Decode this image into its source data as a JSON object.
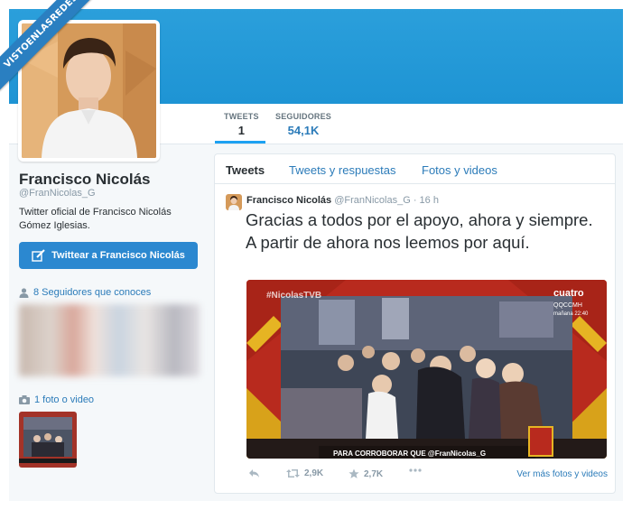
{
  "watermark": {
    "text": "VISTOENLASREDES"
  },
  "profile": {
    "name": "Francisco Nicolás",
    "handle": "@FranNicolas_G",
    "bio": "Twitter oficial de Francisco Nicolás Gómez Iglesias.",
    "tweet_to_button": "Twittear a Francisco Nicolás",
    "followers_you_know": "8 Seguidores que conoces",
    "photos_videos": "1 foto o video"
  },
  "stats": {
    "tweets": {
      "label": "TWEETS",
      "value": "1"
    },
    "followers": {
      "label": "SEGUIDORES",
      "value": "54,1K"
    }
  },
  "timeline": {
    "tabs": [
      "Tweets",
      "Tweets y respuestas",
      "Fotos y videos"
    ],
    "active_tab": "Tweets"
  },
  "tweet": {
    "author": "Francisco Nicolás",
    "handle": "@FranNicolas_G",
    "time": "· 16 h",
    "text": "Gracias a todos por el apoyo, ahora y siempre. A partir de ahora nos leemos por aquí.",
    "media": {
      "overlay_hashtag": "#NicolasTVB",
      "channel_logo": "cuatro",
      "channel_sub": "QQCCMH",
      "channel_time": "mañana 22:40",
      "caption": "PARA CORROBORAR QUE @FranNicolas_G"
    },
    "retweets": "2,9K",
    "favorites": "2,7K",
    "more_media_link": "Ver más fotos y videos"
  },
  "colors": {
    "header": "#1e94d4",
    "link": "#2b7bb9",
    "button": "#2b88d0",
    "muted": "#8899a6"
  }
}
